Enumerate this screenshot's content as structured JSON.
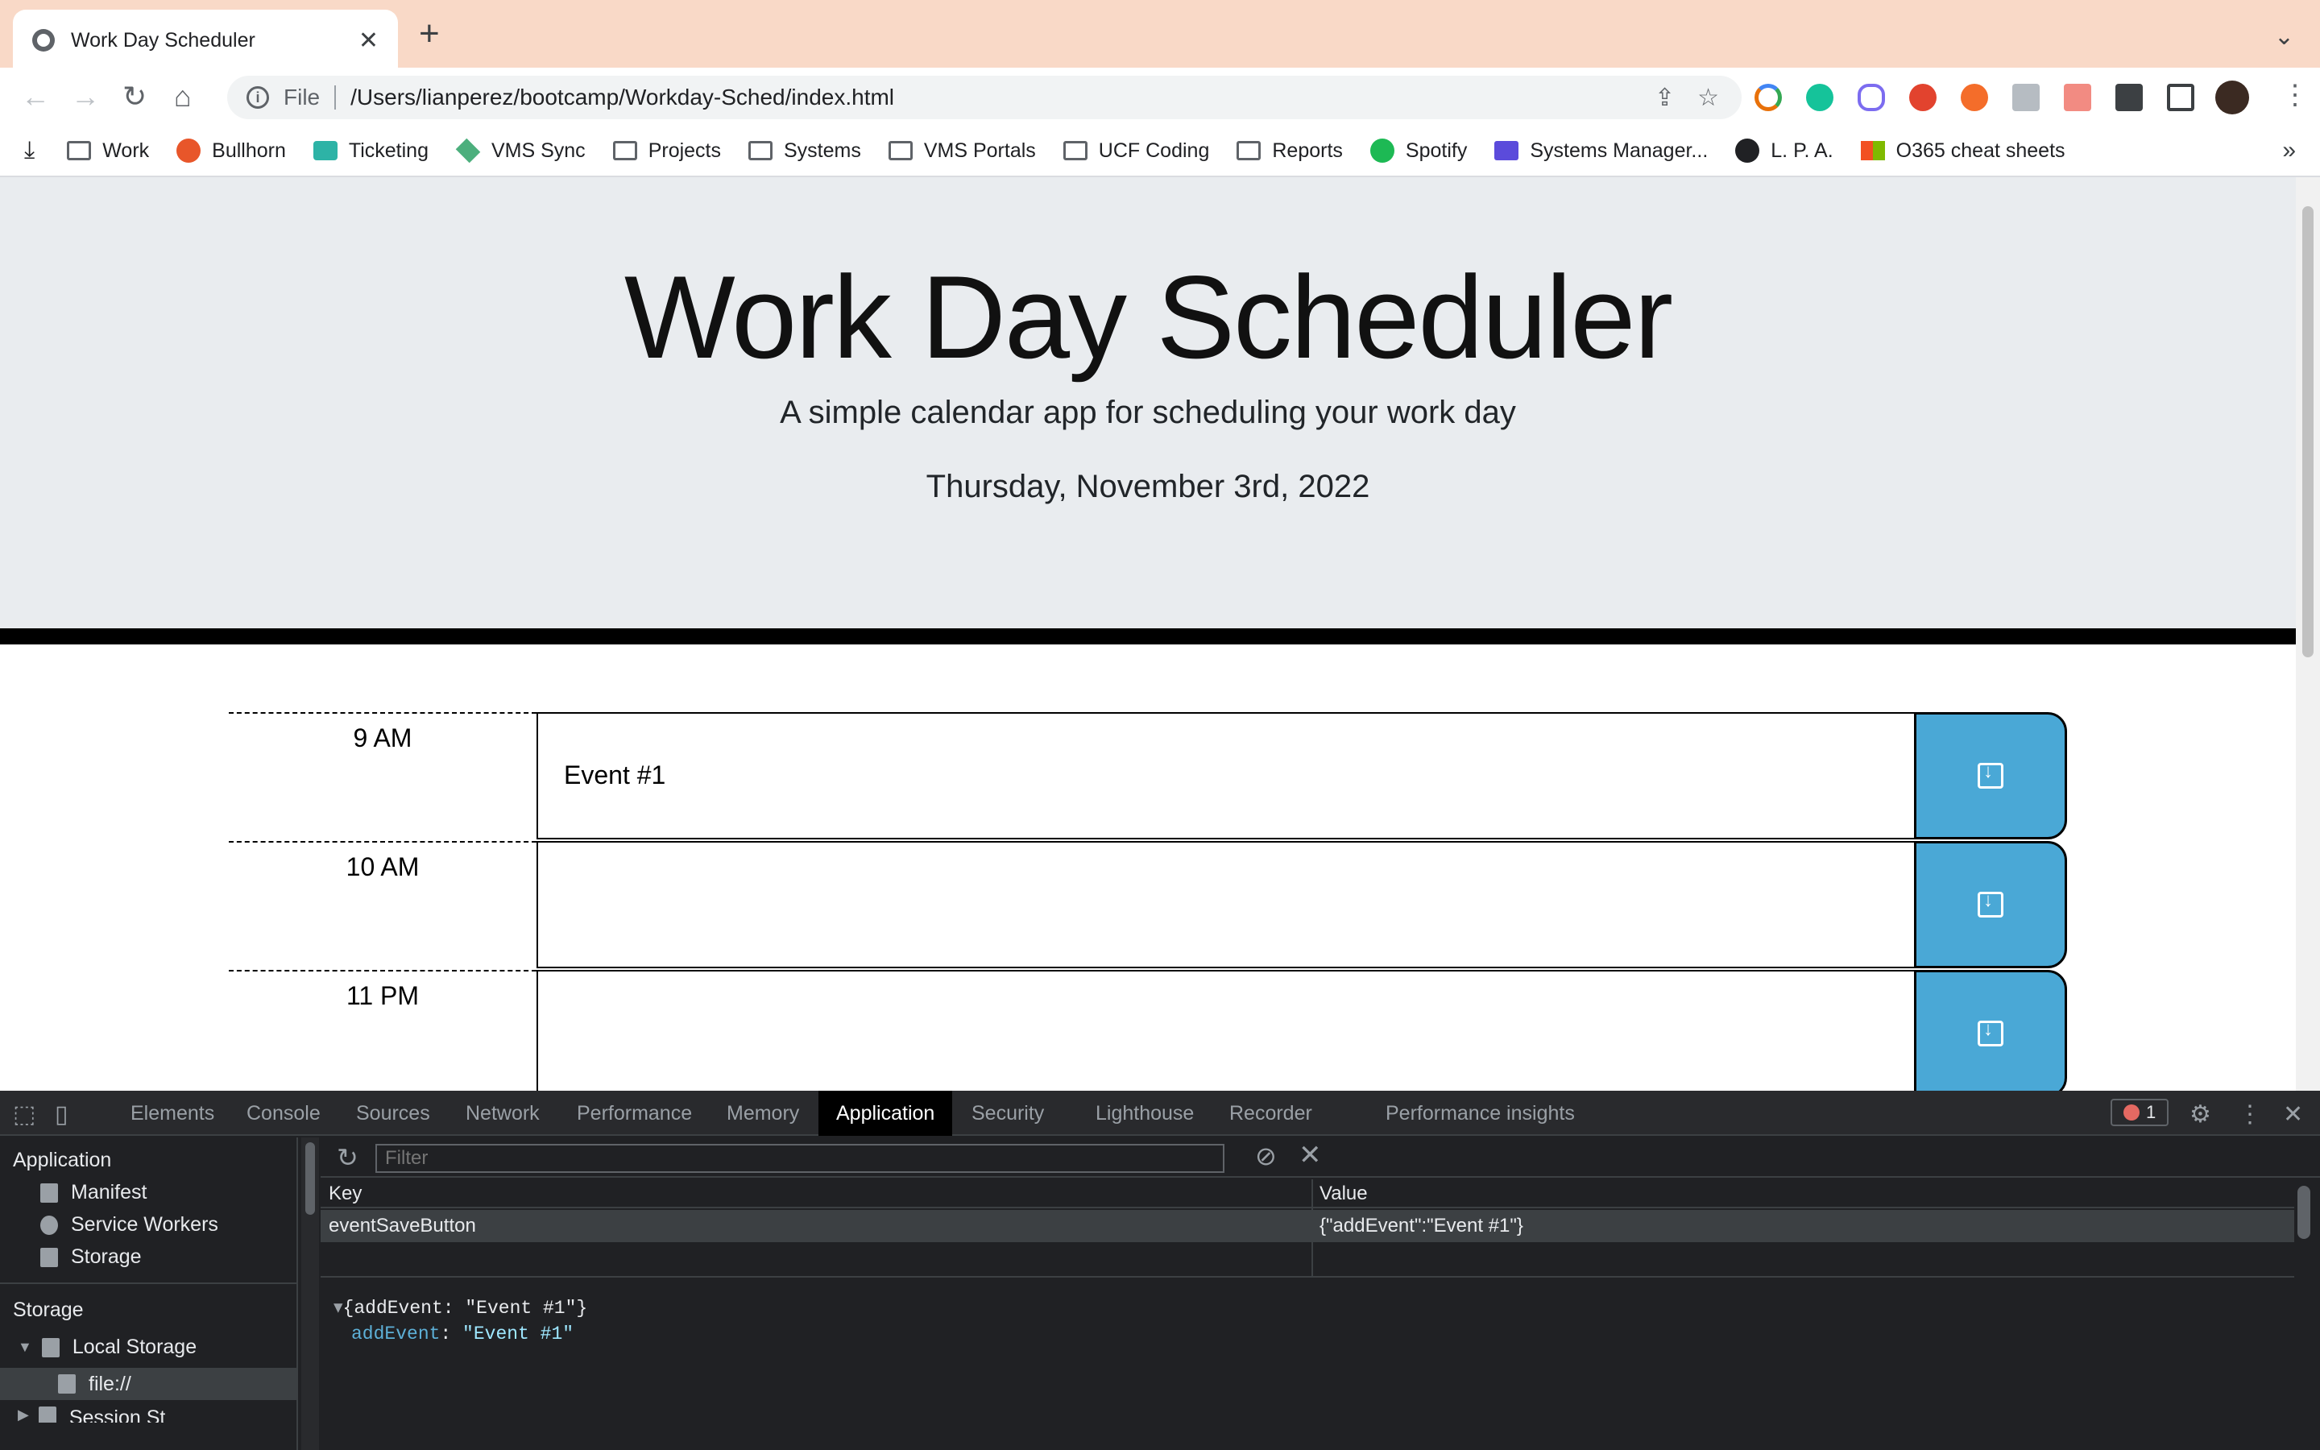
{
  "browser": {
    "tab_title": "Work Day Scheduler",
    "new_tab": "+",
    "scheme": "File",
    "url": "/Users/lianperez/bootcamp/Workday-Sched/index.html",
    "bookmarks": [
      "Work",
      "Bullhorn",
      "Ticketing",
      "VMS Sync",
      "Projects",
      "Systems",
      "VMS Portals",
      "UCF Coding",
      "Reports",
      "Spotify",
      "Systems Manager...",
      "L. P. A.",
      "O365 cheat sheets"
    ],
    "bookmarks_more": "»"
  },
  "page": {
    "title": "Work Day Scheduler",
    "lead": "A simple calendar app for scheduling your work day",
    "date": "Thursday, November 3rd, 2022",
    "rows": [
      {
        "hour": "9 AM",
        "event": "Event #1"
      },
      {
        "hour": "10 AM",
        "event": ""
      },
      {
        "hour": "11 PM",
        "event": ""
      }
    ],
    "accent_color": "#4aa8d6"
  },
  "devtools": {
    "tabs": [
      "Elements",
      "Console",
      "Sources",
      "Network",
      "Performance",
      "Memory",
      "Application",
      "Security",
      "Lighthouse",
      "Recorder",
      "Performance insights"
    ],
    "active_tab": "Application",
    "error_count": "1",
    "sidebar": {
      "application_header": "Application",
      "application_items": [
        "Manifest",
        "Service Workers",
        "Storage"
      ],
      "storage_header": "Storage",
      "local_storage": "Local Storage",
      "origin": "file://",
      "session_storage_partial": "Session St"
    },
    "filter_placeholder": "Filter",
    "table": {
      "key_header": "Key",
      "value_header": "Value",
      "rows": [
        {
          "key": "eventSaveButton",
          "value": "{\"addEvent\":\"Event #1\"}"
        }
      ]
    },
    "preview": {
      "summary": "{addEvent: \"Event #1\"}",
      "prop_key": "addEvent",
      "prop_value": "\"Event #1\""
    }
  }
}
